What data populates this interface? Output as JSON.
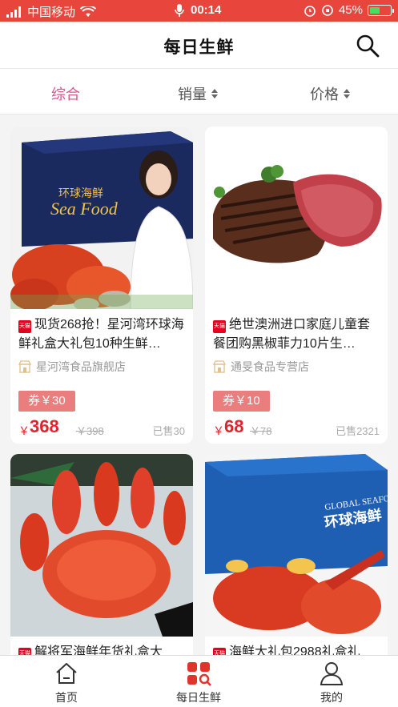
{
  "status_bar": {
    "carrier": "中国移动",
    "time": "00:14",
    "battery": "45%"
  },
  "header": {
    "title": "每日生鲜"
  },
  "sort_bar": {
    "items": [
      {
        "label": "综合",
        "active": true
      },
      {
        "label": "销量",
        "active": false
      },
      {
        "label": "价格",
        "active": false
      }
    ]
  },
  "products": [
    {
      "badge": "天猫",
      "title": "现货268抢！星河湾环球海鲜礼盒大礼包10种生鲜…",
      "shop": "星河湾食品旗舰店",
      "coupon": "券￥30",
      "currency": "￥",
      "price": "368",
      "old_price": "￥398",
      "sold": "已售30"
    },
    {
      "badge": "天猫",
      "title": "绝世澳洲进口家庭儿童套餐团购黑椒菲力10片生…",
      "shop": "通旻食品专营店",
      "coupon": "券￥10",
      "currency": "￥",
      "price": "68",
      "old_price": "￥78",
      "sold": "已售2321"
    },
    {
      "badge": "天猫",
      "title": "解将军海鲜年货礼盒大",
      "shop": "",
      "coupon": "",
      "currency": "",
      "price": "",
      "old_price": "",
      "sold": ""
    },
    {
      "badge": "天猫",
      "title": "海鲜大礼包2988礼盒礼",
      "shop": "",
      "coupon": "",
      "currency": "",
      "price": "",
      "old_price": "",
      "sold": ""
    }
  ],
  "product_images": {
    "p1_box_text_cn": "环球海鲜",
    "p1_box_text_en": "Sea Food",
    "p4_box_text_en": "GLOBAL SEAFOOD",
    "p4_box_text_cn": "环球海鲜"
  },
  "bottom_nav": {
    "items": [
      {
        "label": "首页",
        "icon": "home-icon"
      },
      {
        "label": "每日生鲜",
        "icon": "grid-search-icon",
        "active": true
      },
      {
        "label": "我的",
        "icon": "user-icon"
      }
    ]
  },
  "colors": {
    "status_bar": "#e8453c",
    "active_tab": "#d9578f",
    "price": "#e0242b",
    "coupon": "#ea7d7d",
    "tmall": "#e4001c",
    "nav_active": "#e0342b"
  }
}
